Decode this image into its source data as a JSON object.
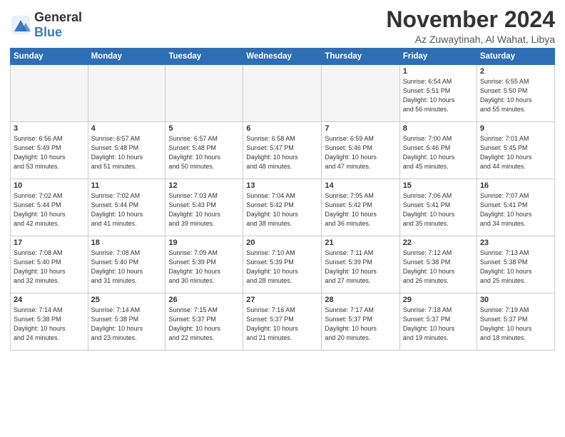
{
  "header": {
    "logo_general": "General",
    "logo_blue": "Blue",
    "month": "November 2024",
    "location": "Az Zuwaytinah, Al Wahat, Libya"
  },
  "weekdays": [
    "Sunday",
    "Monday",
    "Tuesday",
    "Wednesday",
    "Thursday",
    "Friday",
    "Saturday"
  ],
  "weeks": [
    [
      {
        "day": "",
        "info": ""
      },
      {
        "day": "",
        "info": ""
      },
      {
        "day": "",
        "info": ""
      },
      {
        "day": "",
        "info": ""
      },
      {
        "day": "",
        "info": ""
      },
      {
        "day": "1",
        "info": "Sunrise: 6:54 AM\nSunset: 5:51 PM\nDaylight: 10 hours\nand 56 minutes."
      },
      {
        "day": "2",
        "info": "Sunrise: 6:55 AM\nSunset: 5:50 PM\nDaylight: 10 hours\nand 55 minutes."
      }
    ],
    [
      {
        "day": "3",
        "info": "Sunrise: 6:56 AM\nSunset: 5:49 PM\nDaylight: 10 hours\nand 53 minutes."
      },
      {
        "day": "4",
        "info": "Sunrise: 6:57 AM\nSunset: 5:48 PM\nDaylight: 10 hours\nand 51 minutes."
      },
      {
        "day": "5",
        "info": "Sunrise: 6:57 AM\nSunset: 5:48 PM\nDaylight: 10 hours\nand 50 minutes."
      },
      {
        "day": "6",
        "info": "Sunrise: 6:58 AM\nSunset: 5:47 PM\nDaylight: 10 hours\nand 48 minutes."
      },
      {
        "day": "7",
        "info": "Sunrise: 6:59 AM\nSunset: 5:46 PM\nDaylight: 10 hours\nand 47 minutes."
      },
      {
        "day": "8",
        "info": "Sunrise: 7:00 AM\nSunset: 5:46 PM\nDaylight: 10 hours\nand 45 minutes."
      },
      {
        "day": "9",
        "info": "Sunrise: 7:01 AM\nSunset: 5:45 PM\nDaylight: 10 hours\nand 44 minutes."
      }
    ],
    [
      {
        "day": "10",
        "info": "Sunrise: 7:02 AM\nSunset: 5:44 PM\nDaylight: 10 hours\nand 42 minutes."
      },
      {
        "day": "11",
        "info": "Sunrise: 7:02 AM\nSunset: 5:44 PM\nDaylight: 10 hours\nand 41 minutes."
      },
      {
        "day": "12",
        "info": "Sunrise: 7:03 AM\nSunset: 5:43 PM\nDaylight: 10 hours\nand 39 minutes."
      },
      {
        "day": "13",
        "info": "Sunrise: 7:04 AM\nSunset: 5:42 PM\nDaylight: 10 hours\nand 38 minutes."
      },
      {
        "day": "14",
        "info": "Sunrise: 7:05 AM\nSunset: 5:42 PM\nDaylight: 10 hours\nand 36 minutes."
      },
      {
        "day": "15",
        "info": "Sunrise: 7:06 AM\nSunset: 5:41 PM\nDaylight: 10 hours\nand 35 minutes."
      },
      {
        "day": "16",
        "info": "Sunrise: 7:07 AM\nSunset: 5:41 PM\nDaylight: 10 hours\nand 34 minutes."
      }
    ],
    [
      {
        "day": "17",
        "info": "Sunrise: 7:08 AM\nSunset: 5:40 PM\nDaylight: 10 hours\nand 32 minutes."
      },
      {
        "day": "18",
        "info": "Sunrise: 7:08 AM\nSunset: 5:40 PM\nDaylight: 10 hours\nand 31 minutes."
      },
      {
        "day": "19",
        "info": "Sunrise: 7:09 AM\nSunset: 5:39 PM\nDaylight: 10 hours\nand 30 minutes."
      },
      {
        "day": "20",
        "info": "Sunrise: 7:10 AM\nSunset: 5:39 PM\nDaylight: 10 hours\nand 28 minutes."
      },
      {
        "day": "21",
        "info": "Sunrise: 7:11 AM\nSunset: 5:39 PM\nDaylight: 10 hours\nand 27 minutes."
      },
      {
        "day": "22",
        "info": "Sunrise: 7:12 AM\nSunset: 5:38 PM\nDaylight: 10 hours\nand 26 minutes."
      },
      {
        "day": "23",
        "info": "Sunrise: 7:13 AM\nSunset: 5:38 PM\nDaylight: 10 hours\nand 25 minutes."
      }
    ],
    [
      {
        "day": "24",
        "info": "Sunrise: 7:14 AM\nSunset: 5:38 PM\nDaylight: 10 hours\nand 24 minutes."
      },
      {
        "day": "25",
        "info": "Sunrise: 7:14 AM\nSunset: 5:38 PM\nDaylight: 10 hours\nand 23 minutes."
      },
      {
        "day": "26",
        "info": "Sunrise: 7:15 AM\nSunset: 5:37 PM\nDaylight: 10 hours\nand 22 minutes."
      },
      {
        "day": "27",
        "info": "Sunrise: 7:16 AM\nSunset: 5:37 PM\nDaylight: 10 hours\nand 21 minutes."
      },
      {
        "day": "28",
        "info": "Sunrise: 7:17 AM\nSunset: 5:37 PM\nDaylight: 10 hours\nand 20 minutes."
      },
      {
        "day": "29",
        "info": "Sunrise: 7:18 AM\nSunset: 5:37 PM\nDaylight: 10 hours\nand 19 minutes."
      },
      {
        "day": "30",
        "info": "Sunrise: 7:19 AM\nSunset: 5:37 PM\nDaylight: 10 hours\nand 18 minutes."
      }
    ]
  ]
}
